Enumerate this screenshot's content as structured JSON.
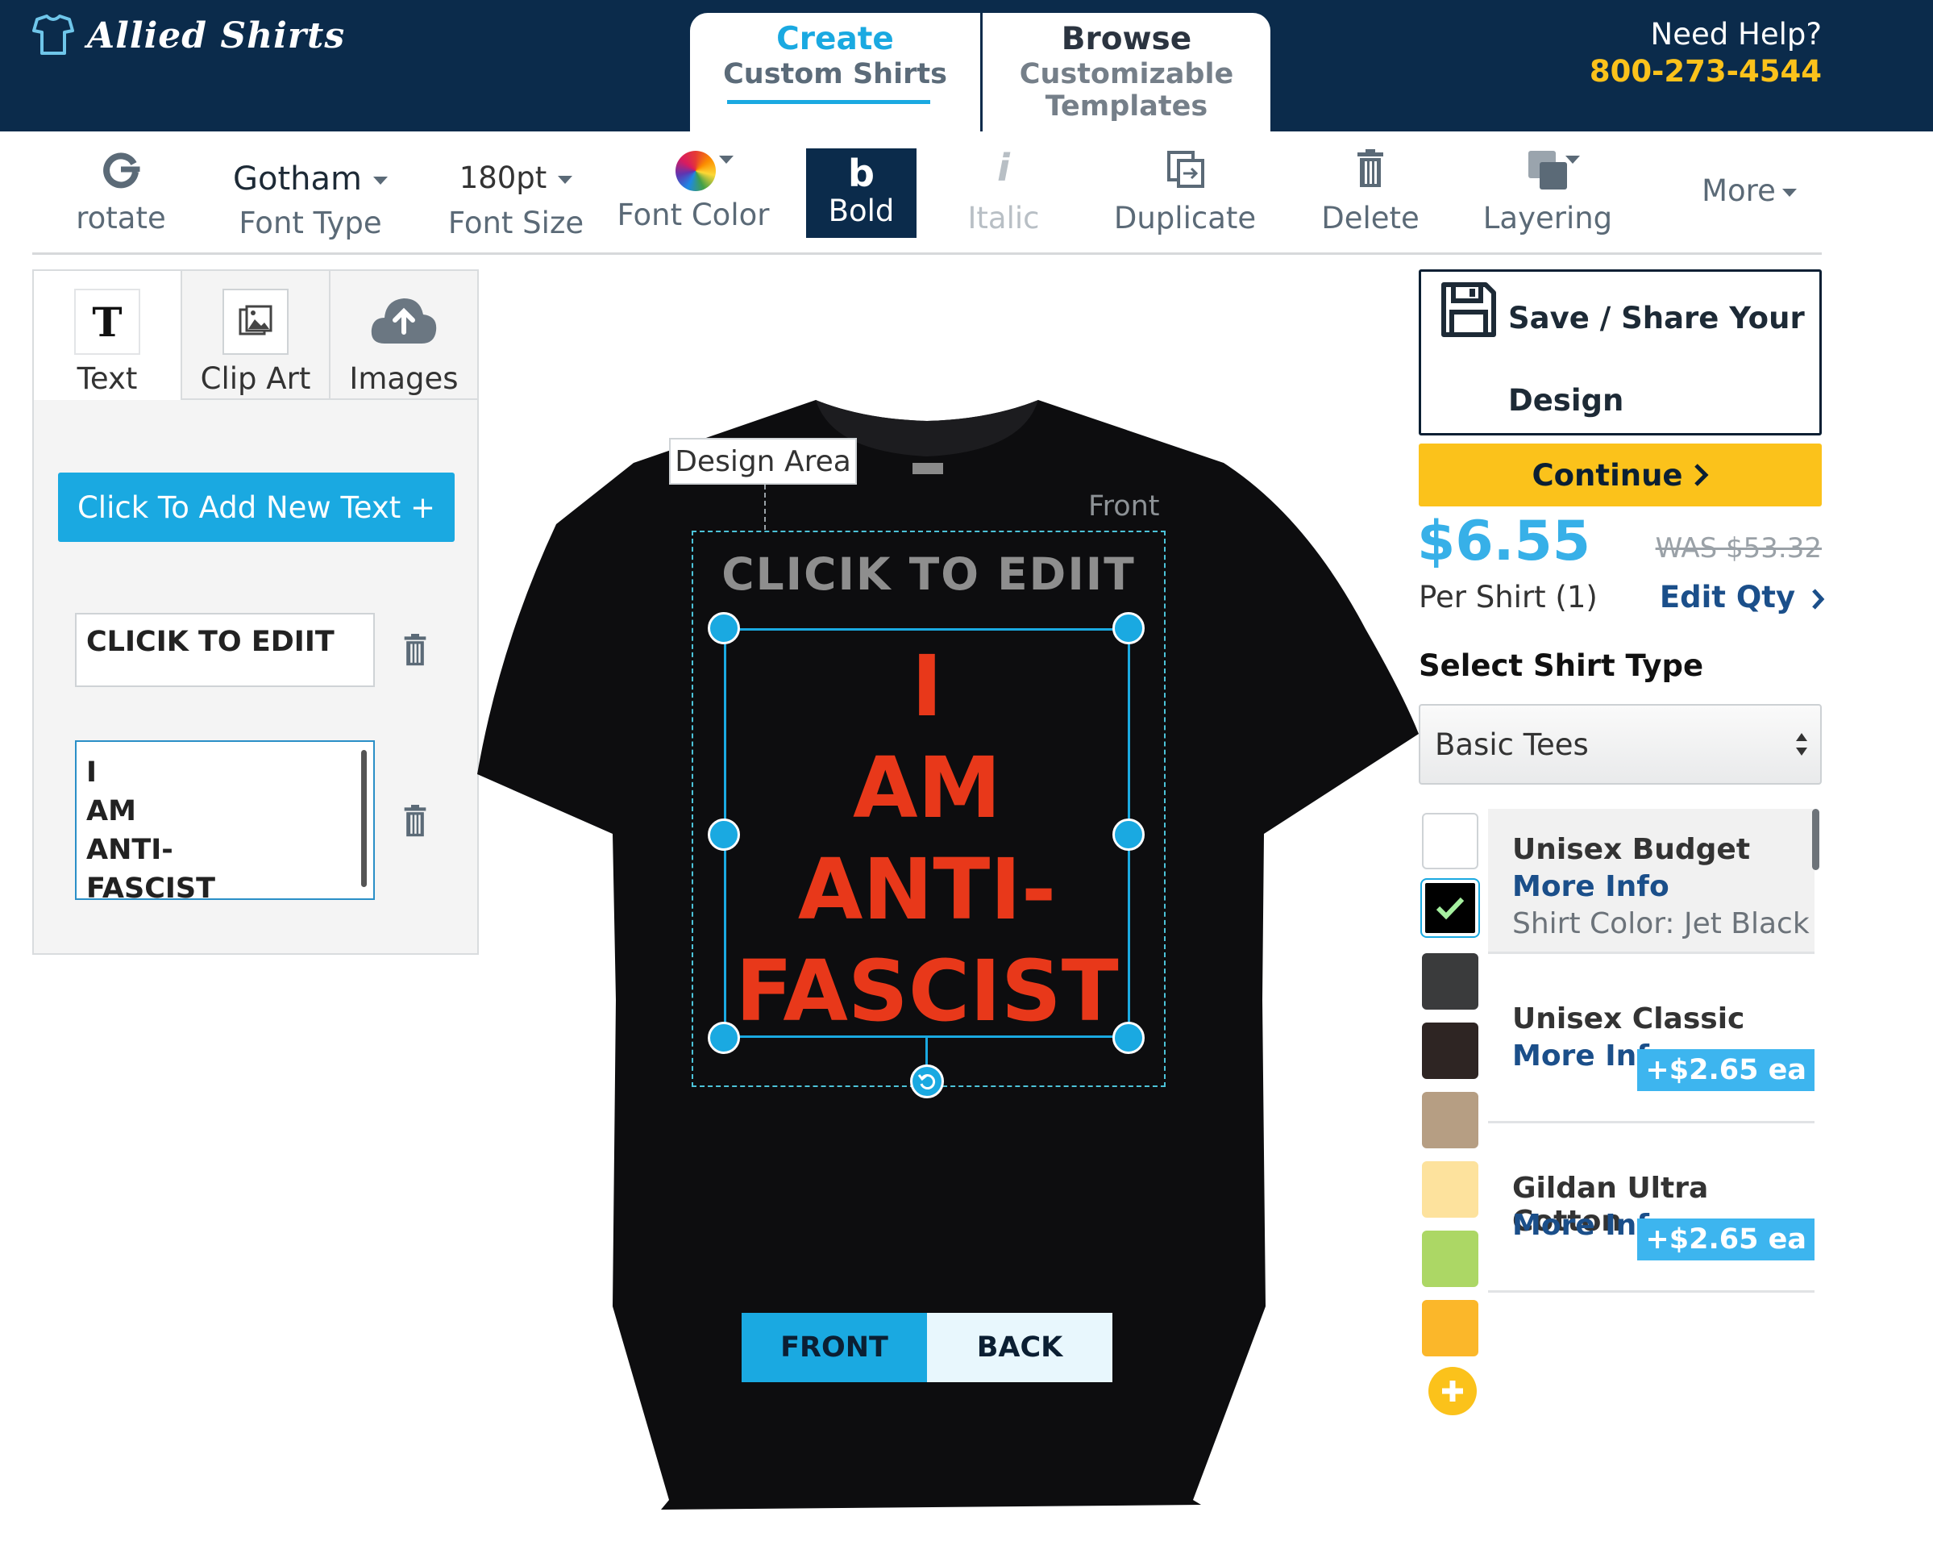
{
  "header": {
    "logo_text": "Allied Shirts",
    "tabs": [
      {
        "title": "Create",
        "subtitle": "Custom Shirts",
        "active": true
      },
      {
        "title": "Browse",
        "subtitle": "Customizable Templates",
        "active": false
      }
    ],
    "help_label": "Need Help?",
    "help_phone": "800-273-4544"
  },
  "toolbar": {
    "rotate": "rotate",
    "font_name": "Gotham",
    "font_type_label": "Font Type",
    "font_size": "180pt",
    "font_size_label": "Font Size",
    "font_color_label": "Font Color",
    "bold_char": "b",
    "bold_label": "Bold",
    "italic_char": "i",
    "italic_label": "Italic",
    "duplicate_label": "Duplicate",
    "delete_label": "Delete",
    "layering_label": "Layering",
    "more_label": "More"
  },
  "left_panel": {
    "tabs": [
      {
        "label": "Text",
        "icon": "text-icon"
      },
      {
        "label": "Clip Art",
        "icon": "clipart-icon"
      },
      {
        "label": "Images",
        "icon": "upload-cloud-icon"
      }
    ],
    "add_text_button": "Click To Add New Text +",
    "text_items": [
      {
        "lines": [
          "CLICIK TO EDIIT"
        ]
      },
      {
        "lines": [
          "I",
          "AM",
          "ANTI-",
          "FASCIST"
        ]
      }
    ]
  },
  "canvas": {
    "design_area_label": "Design Area",
    "side_label": "Front",
    "dim_text": "CLICIK TO EDIIT",
    "main_text_lines": [
      "I",
      "AM",
      "ANTI-",
      "FASCIST"
    ],
    "shirt_color": "#0d0d0f",
    "text_color": "#e8381a",
    "front_button": "FRONT",
    "back_button": "BACK"
  },
  "right_panel": {
    "save_line1": "Save / Share Your",
    "save_line2": "Design",
    "continue_label": "Continue",
    "price": "$6.55",
    "was_price": "WAS $53.32",
    "per_shirt": "Per Shirt (1)",
    "edit_qty": "Edit Qty",
    "select_shirt_type_title": "Select Shirt Type",
    "shirt_type_selected": "Basic Tees",
    "swatches": [
      "#ffffff",
      "#000000",
      "#3a3b3c",
      "#2e2523",
      "#b69e83",
      "#fde29d",
      "#acd765",
      "#fbb72a"
    ],
    "selected_swatch": "#000000",
    "products": [
      {
        "name": "Unisex Budget",
        "more_info": "More Info",
        "shirt_color": "Shirt Color: Jet Black"
      },
      {
        "name": "Unisex Classic",
        "more_info": "More Info",
        "price_tag": "+$2.65 ea"
      },
      {
        "name": "Gildan Ultra Cotton",
        "more_info": "More Info",
        "price_tag": "+$2.65 ea"
      }
    ]
  }
}
